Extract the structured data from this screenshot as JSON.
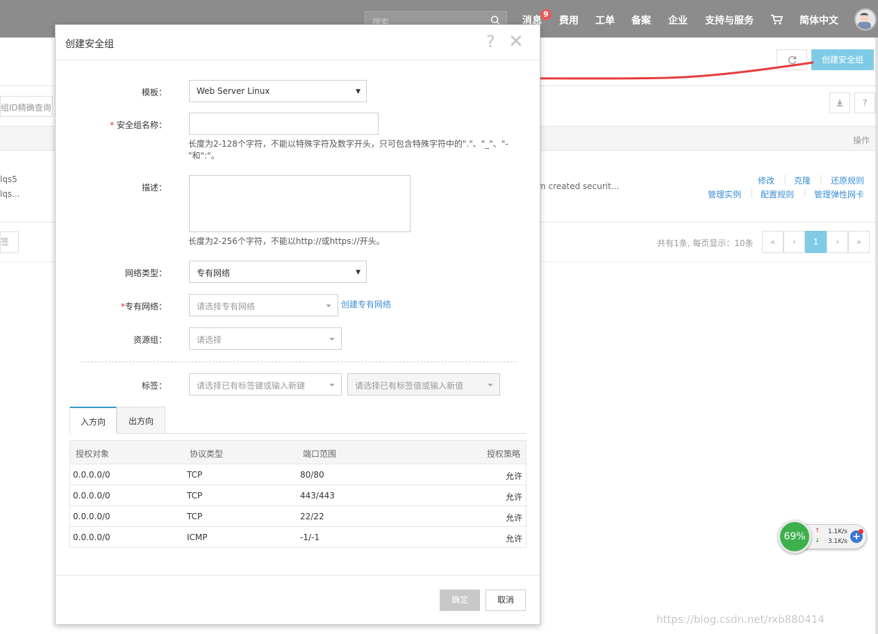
{
  "topbar": {
    "search_placeholder": "搜索",
    "nav_messages": "消息",
    "messages_badge": "9",
    "nav_fees": "费用",
    "nav_tickets": "工单",
    "nav_icp": "备案",
    "nav_enterprise": "企业",
    "nav_support": "支持与服务",
    "nav_language": "简体中文"
  },
  "background": {
    "create_button": "创建安全组",
    "filter_placeholder": "组ID精确查询",
    "op_header": "操作",
    "row_name_1": "lqs5",
    "row_name_2": "lqs...",
    "row_desc": "m created securit...",
    "actions_row1": [
      "修改",
      "克隆",
      "还原规则"
    ],
    "actions_row2": [
      "管理实例",
      "配置规则",
      "管理弹性网卡"
    ],
    "stub_button": "签",
    "pager_info": "共有1条, 每页显示：10条",
    "pager": [
      "«",
      "‹",
      "1",
      "›",
      "»"
    ]
  },
  "dialog": {
    "title": "创建安全组",
    "help": "?",
    "close": "✕",
    "template_label": "模板：",
    "template_value": "Web Server Linux",
    "name_label": "安全组名称：",
    "name_required": "*",
    "name_value": "",
    "name_hint": "长度为2-128个字符，不能以特殊字符及数字开头，只可包含特殊字符中的\".\"、\"_\"、\"-\"和\":\"。",
    "desc_label": "描述：",
    "desc_value": "",
    "desc_hint": "长度为2-256个字符，不能以http://或https://开头。",
    "network_type_label": "网络类型：",
    "network_type_value": "专有网络",
    "vpc_label": "专有网络：",
    "vpc_required": "*",
    "vpc_placeholder": "请选择专有网络",
    "vpc_create_link": "创建专有网络",
    "resource_group_label": "资源组：",
    "resource_group_placeholder": "请选择",
    "tags_label": "标签：",
    "tag_key_placeholder": "请选择已有标签键或输入新键",
    "tag_value_placeholder": "请选择已有标签值或输入新值",
    "tabs": [
      "入方向",
      "出方向"
    ],
    "rules_headers": [
      "授权对象",
      "协议类型",
      "端口范围",
      "授权策略"
    ],
    "rules": [
      {
        "target": "0.0.0.0/0",
        "protocol": "TCP",
        "ports": "80/80",
        "policy": "允许"
      },
      {
        "target": "0.0.0.0/0",
        "protocol": "TCP",
        "ports": "443/443",
        "policy": "允许"
      },
      {
        "target": "0.0.0.0/0",
        "protocol": "TCP",
        "ports": "22/22",
        "policy": "允许"
      },
      {
        "target": "0.0.0.0/0",
        "protocol": "ICMP",
        "ports": "-1/-1",
        "policy": "允许"
      }
    ],
    "ok_button": "确定",
    "cancel_button": "取消"
  },
  "speed_widget": {
    "percent": "69%",
    "upload": "1.1K/s",
    "download": "3.1K/s"
  },
  "watermark": "https://blog.csdn.net/rxb880414",
  "colors": {
    "primary": "#7fcbe6",
    "link": "#3d8fd6",
    "annotation": "#e83a3a"
  }
}
